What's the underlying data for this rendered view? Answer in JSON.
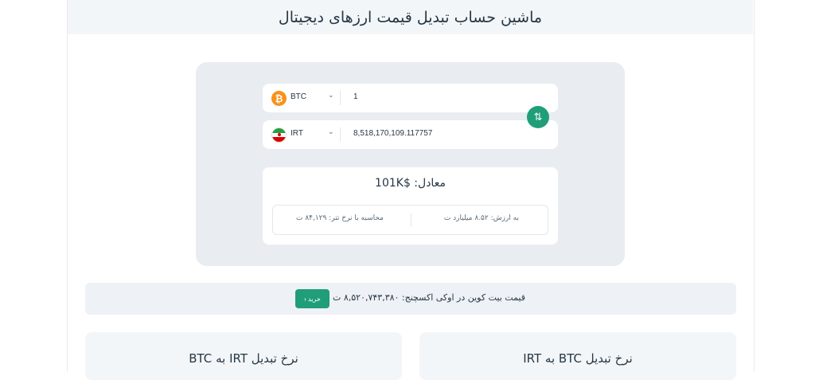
{
  "header": {
    "title": "ماشین حساب تبدیل قیمت ارزهای دیجیتال"
  },
  "converter": {
    "from": {
      "code": "BTC",
      "icon": "bitcoin-icon",
      "amount": "1"
    },
    "to": {
      "code": "IRT",
      "icon": "iran-flag-icon",
      "amount": "8,518,170,109.117757"
    },
    "swap_icon": "⇅"
  },
  "result": {
    "equivalent": "معادل:  $101K",
    "value_text": "به ارزش:  ۸.۵۲ میلیارد ت",
    "rate_text": "محاسبه با نرخ تتر: ۸۴,۱۲۹ ت"
  },
  "banner": {
    "text": "قیمت بیت کوین در اوکی اکسچنج: ۸,۵۲۰,۷۴۳,۳۸۰ ت",
    "buy_label": "خرید  ‹"
  },
  "rate_cards": {
    "left_title": "نرخ تبدیل IRT به BTC",
    "right_title": "نرخ تبدیل BTC به IRT"
  },
  "colors": {
    "accent": "#1f9e79",
    "bitcoin": "#f7931a",
    "card_bg": "#e9edf1"
  }
}
